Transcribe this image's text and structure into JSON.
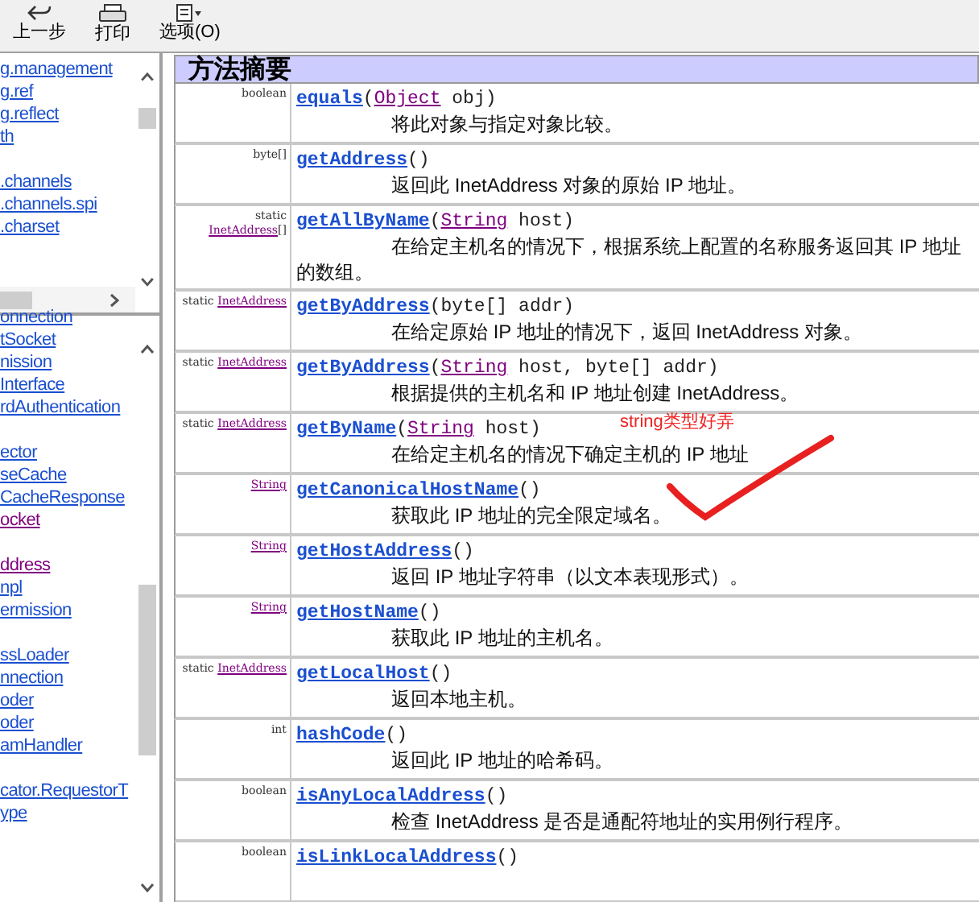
{
  "toolbar": [
    {
      "kind": "back",
      "label": "上一步"
    },
    {
      "kind": "print",
      "label": "打印"
    },
    {
      "kind": "options",
      "label": "选项(O)"
    }
  ],
  "package_list": [
    [
      "g.management",
      "g.ref",
      "g.reflect",
      "th"
    ],
    [
      ".channels",
      ".channels.spi",
      ".charset"
    ]
  ],
  "class_list": [
    [
      {
        "text": "onnection",
        "visited": false
      },
      {
        "text": "tSocket",
        "visited": false
      },
      {
        "text": "nission",
        "visited": false
      },
      {
        "text": "Interface",
        "visited": false
      },
      {
        "text": "rdAuthentication",
        "visited": false
      }
    ],
    [
      {
        "text": "ector",
        "visited": false
      },
      {
        "text": "seCache",
        "visited": false
      },
      {
        "text": "CacheResponse",
        "visited": false
      },
      {
        "text": "ocket",
        "visited": true
      }
    ],
    [
      {
        "text": "ddress",
        "visited": true
      },
      {
        "text": "npl",
        "visited": false
      },
      {
        "text": "ermission",
        "visited": false
      }
    ],
    [
      {
        "text": "ssLoader",
        "visited": false
      },
      {
        "text": "nnection",
        "visited": false
      },
      {
        "text": "oder",
        "visited": false
      },
      {
        "text": "oder",
        "visited": false
      },
      {
        "text": "amHandler",
        "visited": false
      }
    ],
    [
      {
        "text": "cator.RequestorT",
        "visited": false
      },
      {
        "text": "ype",
        "visited": false
      }
    ]
  ],
  "section_title": "方法摘要",
  "methods": [
    {
      "modifier": [
        {
          "kind": "text",
          "text": "boolean"
        }
      ],
      "name": "equals",
      "params": [
        {
          "kind": "text",
          "text": "("
        },
        {
          "kind": "link",
          "text": "Object"
        },
        {
          "kind": "text",
          "text": " obj)"
        }
      ],
      "description": [
        "将此对象与指定对象比较。"
      ]
    },
    {
      "modifier": [
        {
          "kind": "text",
          "text": "byte[]"
        }
      ],
      "name": "getAddress",
      "params": [
        {
          "kind": "text",
          "text": "()"
        }
      ],
      "description": [
        "返回此 InetAddress 对象的原始 IP 地址。"
      ]
    },
    {
      "modifier": [
        {
          "kind": "text",
          "text": "static "
        },
        {
          "kind": "link",
          "text": "InetAddress"
        },
        {
          "kind": "text",
          "text": "[]"
        }
      ],
      "name": "getAllByName",
      "params": [
        {
          "kind": "text",
          "text": "("
        },
        {
          "kind": "link",
          "text": "String"
        },
        {
          "kind": "text",
          "text": " host)"
        }
      ],
      "description": [
        "在给定主机名的情况下，根据系统上配置的名称服务返回其 IP 地址",
        "的数组。"
      ]
    },
    {
      "modifier": [
        {
          "kind": "text",
          "text": "static "
        },
        {
          "kind": "link",
          "text": "InetAddress"
        }
      ],
      "name": "getByAddress",
      "params": [
        {
          "kind": "text",
          "text": "(byte[] addr)"
        }
      ],
      "description": [
        "在给定原始 IP 地址的情况下，返回 InetAddress 对象。"
      ]
    },
    {
      "modifier": [
        {
          "kind": "text",
          "text": "static "
        },
        {
          "kind": "link",
          "text": "InetAddress"
        }
      ],
      "name": "getByAddress",
      "params": [
        {
          "kind": "text",
          "text": "("
        },
        {
          "kind": "link",
          "text": "String"
        },
        {
          "kind": "text",
          "text": " host, byte[] addr)"
        }
      ],
      "description": [
        "根据提供的主机名和 IP 地址创建 InetAddress。"
      ]
    },
    {
      "modifier": [
        {
          "kind": "text",
          "text": "static "
        },
        {
          "kind": "link",
          "text": "InetAddress"
        }
      ],
      "name": "getByName",
      "params": [
        {
          "kind": "text",
          "text": "("
        },
        {
          "kind": "link",
          "text": "String"
        },
        {
          "kind": "text",
          "text": " host)"
        }
      ],
      "description": [
        "在给定主机名的情况下确定主机的 IP 地址"
      ]
    },
    {
      "modifier": [
        {
          "kind": "link",
          "text": "String"
        }
      ],
      "name": "getCanonicalHostName",
      "params": [
        {
          "kind": "text",
          "text": "()"
        }
      ],
      "description": [
        "获取此 IP 地址的完全限定域名。"
      ]
    },
    {
      "modifier": [
        {
          "kind": "link",
          "text": "String"
        }
      ],
      "name": "getHostAddress",
      "params": [
        {
          "kind": "text",
          "text": "()"
        }
      ],
      "description": [
        "返回 IP 地址字符串（以文本表现形式）。"
      ]
    },
    {
      "modifier": [
        {
          "kind": "link",
          "text": "String"
        }
      ],
      "name": "getHostName",
      "params": [
        {
          "kind": "text",
          "text": "()"
        }
      ],
      "description": [
        "获取此 IP 地址的主机名。"
      ]
    },
    {
      "modifier": [
        {
          "kind": "text",
          "text": "static "
        },
        {
          "kind": "link",
          "text": "InetAddress"
        }
      ],
      "name": "getLocalHost",
      "params": [
        {
          "kind": "text",
          "text": "()"
        }
      ],
      "description": [
        "返回本地主机。"
      ]
    },
    {
      "modifier": [
        {
          "kind": "text",
          "text": "int"
        }
      ],
      "name": "hashCode",
      "params": [
        {
          "kind": "text",
          "text": "()"
        }
      ],
      "description": [
        "返回此 IP 地址的哈希码。"
      ]
    },
    {
      "modifier": [
        {
          "kind": "text",
          "text": "boolean"
        }
      ],
      "name": "isAnyLocalAddress",
      "params": [
        {
          "kind": "text",
          "text": "()"
        }
      ],
      "description": [
        "检查 InetAddress 是否是通配符地址的实用例行程序。"
      ]
    },
    {
      "modifier": [
        {
          "kind": "text",
          "text": "boolean"
        }
      ],
      "name": "isLinkLocalAddress",
      "params": [
        {
          "kind": "text",
          "text": "()"
        }
      ]
    }
  ],
  "annotation": {
    "text": "string类型好弄"
  }
}
